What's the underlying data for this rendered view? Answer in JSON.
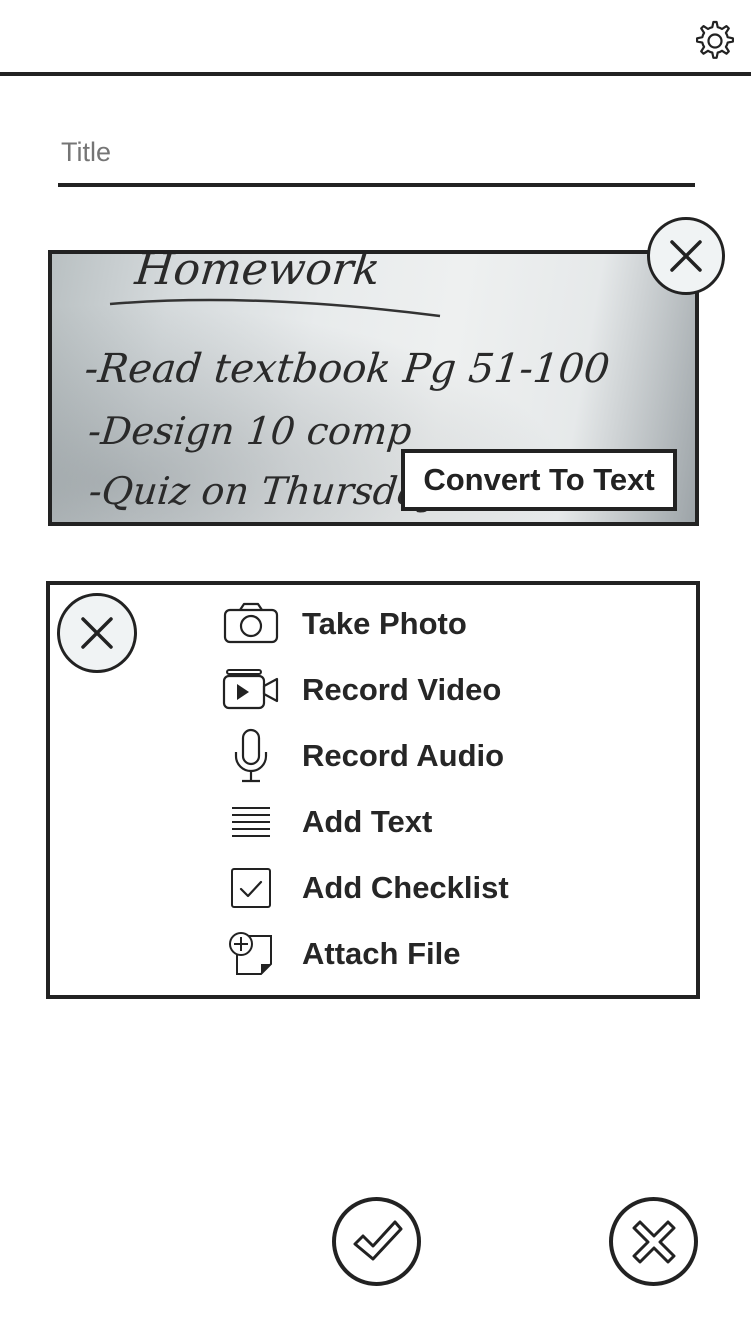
{
  "header": {
    "settings_icon": "gear-icon"
  },
  "title_field": {
    "placeholder": "Title",
    "value": ""
  },
  "photo": {
    "handwriting_lines": [
      "Homework",
      "-Read textbook Pg 51-100",
      "-Design 10 comp",
      "-Quiz on Thursday"
    ],
    "convert_label": "Convert To Text",
    "close_icon": "close-icon"
  },
  "attach_menu": {
    "close_icon": "close-icon",
    "items": [
      {
        "label": "Take Photo",
        "icon": "camera-icon"
      },
      {
        "label": "Record Video",
        "icon": "video-camera-icon"
      },
      {
        "label": "Record Audio",
        "icon": "microphone-icon"
      },
      {
        "label": "Add Text",
        "icon": "text-lines-icon"
      },
      {
        "label": "Add Checklist",
        "icon": "checklist-icon"
      },
      {
        "label": "Attach File",
        "icon": "attach-file-icon"
      }
    ]
  },
  "actions": {
    "confirm_icon": "checkmark-icon",
    "cancel_icon": "close-icon"
  }
}
